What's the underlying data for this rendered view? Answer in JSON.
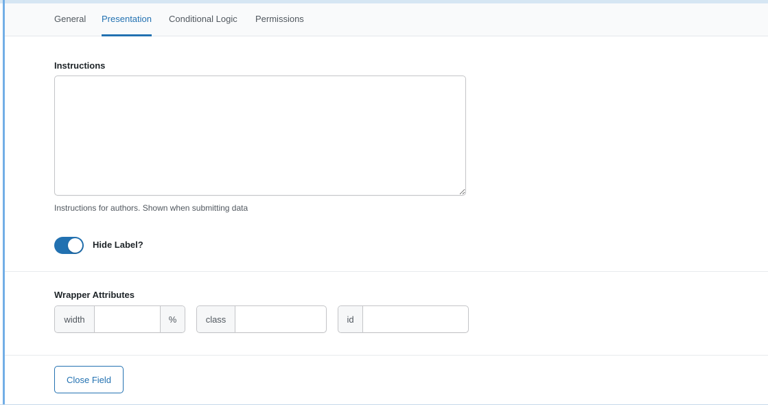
{
  "tabs": [
    {
      "label": "General",
      "active": false
    },
    {
      "label": "Presentation",
      "active": true
    },
    {
      "label": "Conditional Logic",
      "active": false
    },
    {
      "label": "Permissions",
      "active": false
    }
  ],
  "instructions": {
    "label": "Instructions",
    "value": "",
    "help": "Instructions for authors. Shown when submitting data"
  },
  "hide_label": {
    "label": "Hide Label?",
    "enabled": true
  },
  "wrapper": {
    "label": "Wrapper Attributes",
    "width": {
      "prepend": "width",
      "value": "",
      "append": "%"
    },
    "class": {
      "prepend": "class",
      "value": ""
    },
    "id": {
      "prepend": "id",
      "value": ""
    }
  },
  "close_button": {
    "label": "Close Field"
  },
  "colors": {
    "accent": "#2271b1",
    "left_border": "#72aee6",
    "tab_bar_bg": "#f9fafb"
  }
}
